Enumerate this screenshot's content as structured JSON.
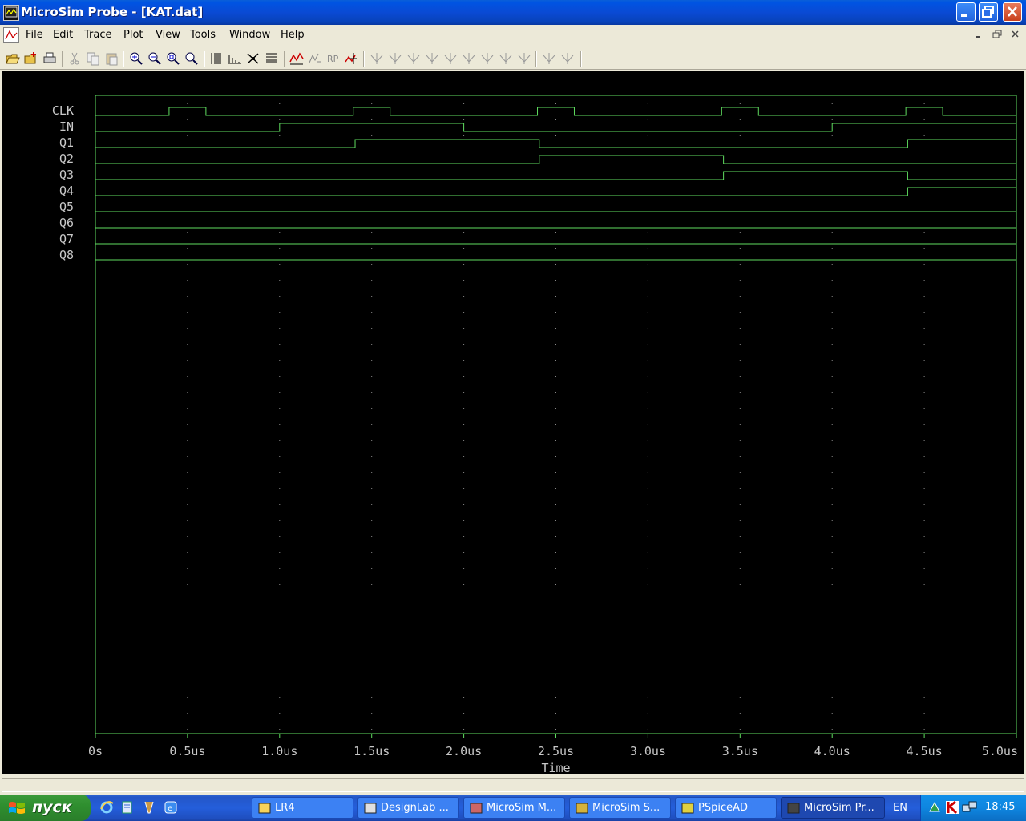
{
  "window": {
    "title": "MicroSim Probe - [KAT.dat]"
  },
  "menu": {
    "items": [
      "File",
      "Edit",
      "Trace",
      "Plot",
      "View",
      "Tools",
      "Window",
      "Help"
    ]
  },
  "toolbar": {
    "icons": [
      "open-icon",
      "open-append-icon",
      "print-icon",
      "cut-icon",
      "copy-icon",
      "paste-icon",
      "zoom-in-icon",
      "zoom-out-icon",
      "zoom-area-icon",
      "zoom-fit-icon",
      "log-x-icon",
      "fourier-icon",
      "performance-icon",
      "log-y-icon",
      "add-trace-icon",
      "eval-goal-icon",
      "mark-label-icon",
      "cursor-icon",
      "cursor-peak-icon",
      "cursor-trough-icon",
      "cursor-slope-icon",
      "cursor-min-icon",
      "cursor-max-icon",
      "cursor-point-icon",
      "cursor-search-icon",
      "cursor-next-transition-icon",
      "cursor-prev-transition-icon",
      "mark-data-icon",
      "toggle-symbol-icon"
    ]
  },
  "chart_data": {
    "type": "digital-timing",
    "xlabel": "Time",
    "xlim": [
      0,
      5.0
    ],
    "x_unit": "us",
    "x_ticks": [
      "0s",
      "0.5us",
      "1.0us",
      "1.5us",
      "2.0us",
      "2.5us",
      "3.0us",
      "3.5us",
      "4.0us",
      "4.5us",
      "5.0us"
    ],
    "grid": true,
    "series": [
      {
        "name": "CLK",
        "initial": 0,
        "transitions": [
          0.4,
          0.6,
          1.4,
          1.6,
          2.4,
          2.6,
          3.4,
          3.6,
          4.4,
          4.6
        ]
      },
      {
        "name": "IN",
        "initial": 0,
        "transitions": [
          1.0,
          2.0,
          4.0
        ]
      },
      {
        "name": "Q1",
        "initial": 0,
        "transitions": [
          1.41,
          2.41,
          4.41
        ]
      },
      {
        "name": "Q2",
        "initial": 0,
        "transitions": [
          2.41,
          3.41
        ]
      },
      {
        "name": "Q3",
        "initial": 0,
        "transitions": [
          3.41,
          4.41
        ]
      },
      {
        "name": "Q4",
        "initial": 0,
        "transitions": [
          4.41
        ]
      },
      {
        "name": "Q5",
        "initial": 0,
        "transitions": []
      },
      {
        "name": "Q6",
        "initial": 0,
        "transitions": []
      },
      {
        "name": "Q7",
        "initial": 0,
        "transitions": []
      },
      {
        "name": "Q8",
        "initial": 0,
        "transitions": []
      }
    ],
    "colors": {
      "background": "#000000",
      "trace": "#5fdc5f",
      "frame": "#5fdc5f",
      "text": "#c8c8c8",
      "grid": "#8a8a8a"
    }
  },
  "taskbar": {
    "start_label": "пуск",
    "tasks": [
      {
        "label": "LR4",
        "icon": "folder-icon"
      },
      {
        "label": "DesignLab ...",
        "icon": "designlab-icon"
      },
      {
        "label": "MicroSim M...",
        "icon": "microsim-m-icon"
      },
      {
        "label": "MicroSim S...",
        "icon": "microsim-s-icon"
      },
      {
        "label": "PSpiceAD",
        "icon": "pspice-icon"
      },
      {
        "label": "MicroSim Pr...",
        "icon": "probe-icon"
      }
    ],
    "language": "EN",
    "clock": "18:45"
  }
}
